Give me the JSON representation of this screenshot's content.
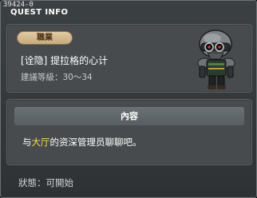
{
  "window": {
    "quest_id": "39424-0",
    "title": "QUEST INFO",
    "close_label": "×"
  },
  "quest": {
    "job_badge": "職業",
    "name": "[诠隐] 提拉格的心计",
    "level_label": "建議等級：",
    "level_range": "30～34"
  },
  "content": {
    "header": "內容",
    "desc_before": "与",
    "desc_highlight": "大厅",
    "desc_after": "的资深管理员聊聊吧。"
  },
  "status": {
    "label": "狀態：",
    "value": "可開始"
  },
  "colors": {
    "highlight": "#f6dc48",
    "badge": "#d6bb8f",
    "panel": "#474b4e"
  }
}
